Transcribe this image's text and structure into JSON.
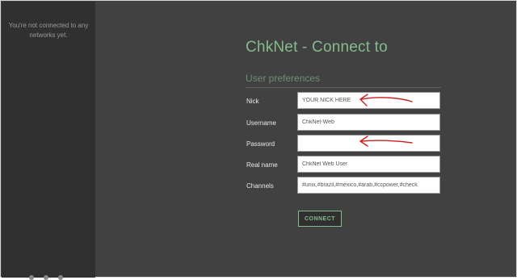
{
  "sidebar": {
    "message": "You're not connected to any networks yet."
  },
  "page": {
    "title": "ChkNet - Connect to"
  },
  "section": {
    "title": "User preferences"
  },
  "fields": {
    "nick": {
      "label": "Nick",
      "value": "YOUR NICK HERE"
    },
    "username": {
      "label": "Username",
      "value": "ChkNet-Web"
    },
    "password": {
      "label": "Password",
      "value": ""
    },
    "realname": {
      "label": "Real name",
      "value": "ChkNet Web User"
    },
    "channels": {
      "label": "Channels",
      "value": "#unix,#brazil,#mexico,#arab,#ccpower,#check"
    }
  },
  "connect_button": {
    "label": "CONNECT"
  },
  "colors": {
    "accent": "#86ba8c",
    "annotation": "#cc1f1f",
    "background": "#414141",
    "sidebar": "#303030"
  }
}
